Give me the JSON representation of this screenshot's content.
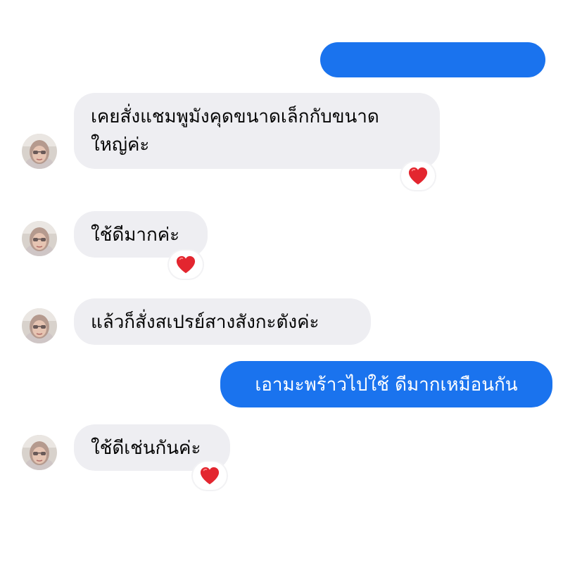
{
  "thread": {
    "messages": [
      {
        "direction": "outgoing",
        "text": "",
        "partially_visible": true
      },
      {
        "direction": "incoming",
        "text_lines": [
          "เคยสั่งแชมพูมังคุดขนาดเล็กกับขนาด",
          "ใหญ่ค่ะ"
        ],
        "reaction": "heart-icon"
      },
      {
        "direction": "incoming",
        "text": "ใช้ดีมากค่ะ",
        "reaction": "heart-icon"
      },
      {
        "direction": "incoming",
        "text": "แล้วก็สั่งสเปรย์สางสังกะตังค่ะ"
      },
      {
        "direction": "outgoing",
        "text": "เอามะพร้าวไปใช้ ดีมากเหมือนกัน"
      },
      {
        "direction": "incoming",
        "text": "ใช้ดีเช่นกันค่ะ",
        "reaction": "heart-icon"
      }
    ]
  },
  "colors": {
    "incoming_bubble": "#eeeef2",
    "outgoing_bubble": "#1a73ee",
    "heart": "#e3262f"
  }
}
